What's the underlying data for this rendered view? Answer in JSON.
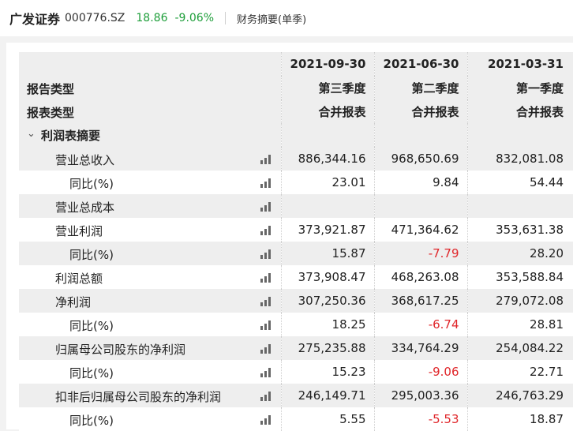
{
  "header": {
    "stock_name": "广发证券",
    "stock_code": "000776.SZ",
    "price": "18.86",
    "change_pct": "-9.06%",
    "section_title": "财务摘要(单季)"
  },
  "table": {
    "columns": [
      {
        "date": "2021-09-30",
        "report_type": "第三季度",
        "statement_type": "合并报表"
      },
      {
        "date": "2021-06-30",
        "report_type": "第二季度",
        "statement_type": "合并报表"
      },
      {
        "date": "2021-03-31",
        "report_type": "第一季度",
        "statement_type": "合并报表"
      }
    ],
    "row_header_report_type": "报告类型",
    "row_header_statement_type": "报表类型",
    "section_label": "利润表摘要",
    "rows": [
      {
        "label": "营业总收入",
        "values": [
          "886,344.16",
          "968,650.69",
          "832,081.08"
        ]
      },
      {
        "label": "同比(%)",
        "values": [
          "23.01",
          "9.84",
          "54.44"
        ]
      },
      {
        "label": "营业总成本",
        "values": [
          "",
          "",
          ""
        ]
      },
      {
        "label": "营业利润",
        "values": [
          "373,921.87",
          "471,364.62",
          "353,631.38"
        ]
      },
      {
        "label": "同比(%)",
        "values": [
          "15.87",
          "-7.79",
          "28.20"
        ]
      },
      {
        "label": "利润总额",
        "values": [
          "373,908.47",
          "468,263.08",
          "353,588.84"
        ]
      },
      {
        "label": "净利润",
        "values": [
          "307,250.36",
          "368,617.25",
          "279,072.08"
        ]
      },
      {
        "label": "同比(%)",
        "values": [
          "18.25",
          "-6.74",
          "28.81"
        ]
      },
      {
        "label": "归属母公司股东的净利润",
        "values": [
          "275,235.88",
          "334,764.29",
          "254,084.22"
        ]
      },
      {
        "label": "同比(%)",
        "values": [
          "15.23",
          "-9.06",
          "22.71"
        ]
      },
      {
        "label": "扣非后归属母公司股东的净利润",
        "values": [
          "246,149.71",
          "295,003.36",
          "246,763.29"
        ]
      },
      {
        "label": "同比(%)",
        "values": [
          "5.55",
          "-5.53",
          "18.87"
        ]
      }
    ]
  },
  "colors": {
    "up": "#e0262a",
    "down": "#1e9e3a"
  }
}
